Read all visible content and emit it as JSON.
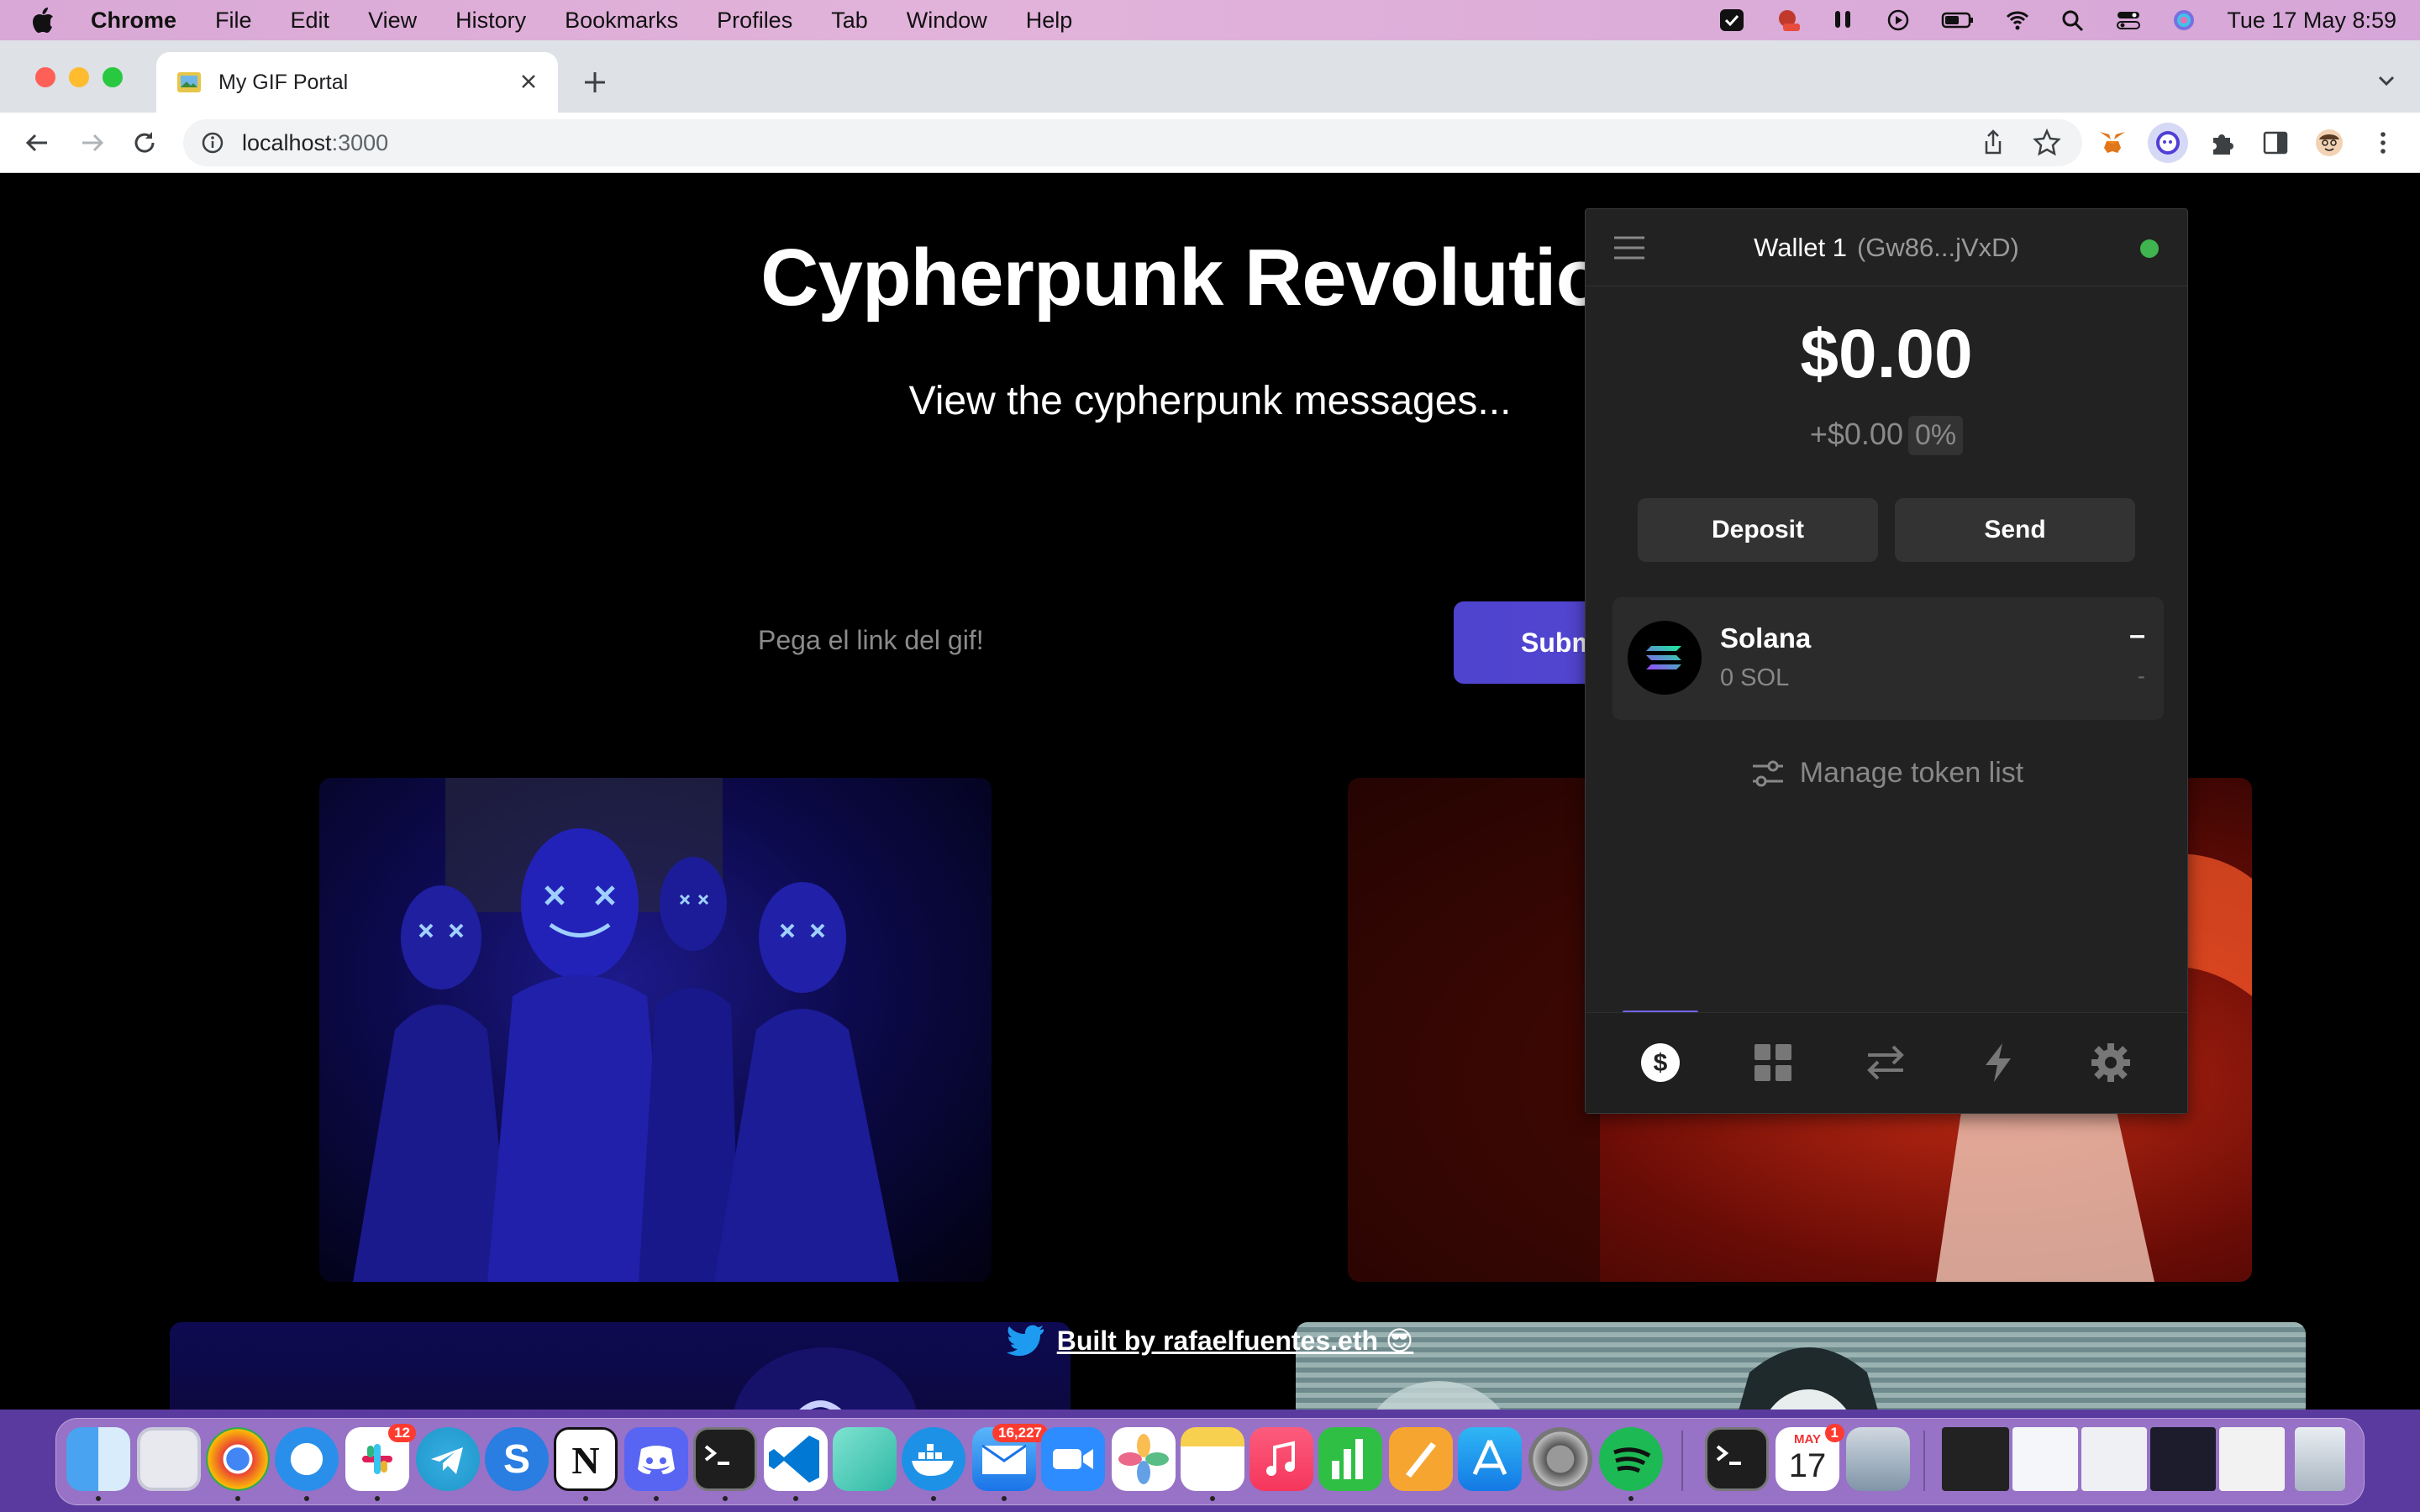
{
  "menubar": {
    "app": "Chrome",
    "items": [
      "File",
      "Edit",
      "View",
      "History",
      "Bookmarks",
      "Profiles",
      "Tab",
      "Window",
      "Help"
    ],
    "clock": "Tue 17 May  8:59"
  },
  "browser": {
    "tab_title": "My GIF Portal",
    "url_host": "localhost",
    "url_port": ":3000"
  },
  "page": {
    "title": "Cypherpunk Revolution",
    "subtitle": "View the cypherpunk messages...",
    "input_placeholder": "Pega el link del gif!",
    "submit_label": "Submit",
    "footer_link": "Built by rafaelfuentes.eth 😎"
  },
  "wallet": {
    "name": "Wallet 1",
    "address": "(Gw86...jVxD)",
    "balance": "$0.00",
    "change": "+$0.00",
    "change_pct": "0%",
    "deposit_label": "Deposit",
    "send_label": "Send",
    "token": {
      "name": "Solana",
      "amount": "0 SOL",
      "value": "–",
      "change": "-"
    },
    "manage_label": "Manage token list",
    "status_color": "#3fb44f",
    "tabs": [
      "dollar-icon",
      "grid-icon",
      "swap-icon",
      "lightning-icon",
      "gear-icon"
    ]
  },
  "dock": {
    "badges": {
      "slack": "12",
      "mail": "16,227",
      "calendar": "1"
    },
    "calendar_month": "MAY",
    "calendar_day": "17"
  }
}
